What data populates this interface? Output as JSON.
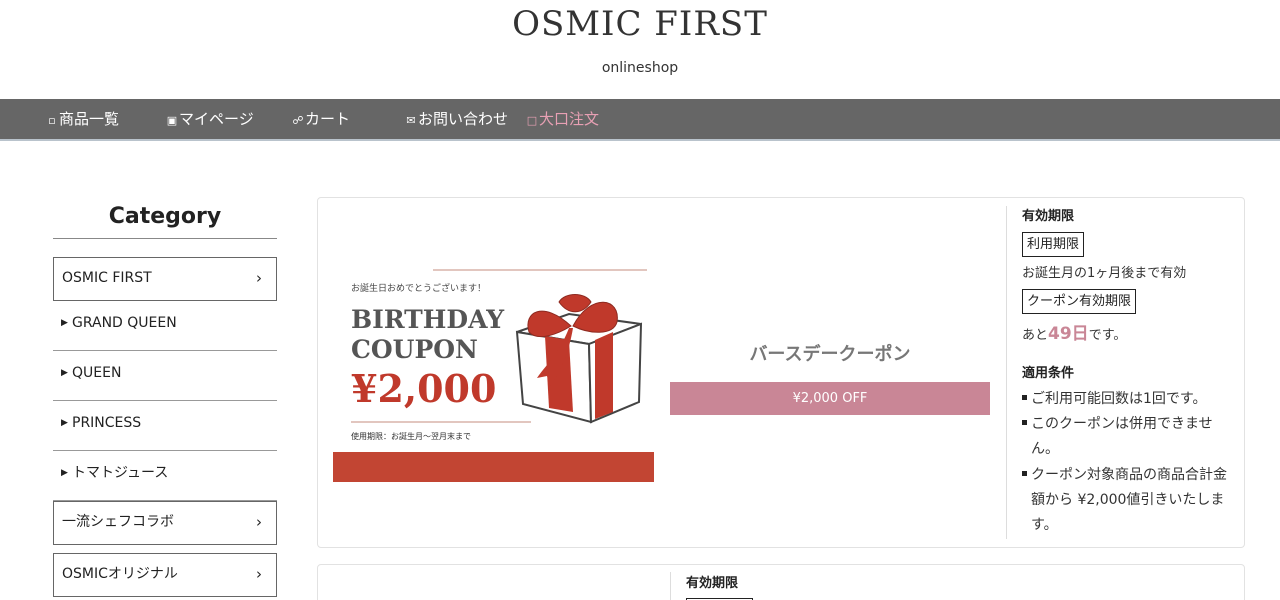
{
  "header": {
    "brand": "OSMIC FIRST",
    "subtitle": "onlineshop"
  },
  "nav": [
    {
      "label": "商品一覧",
      "icon": "shopping-bag-icon"
    },
    {
      "label": "マイページ",
      "icon": "lock-icon"
    },
    {
      "label": "カート",
      "icon": "cart-icon"
    },
    {
      "label": "お問い合わせ",
      "icon": "mail-icon"
    },
    {
      "label": "大口注文",
      "icon": "chat-icon",
      "color": "#e8a0b4"
    }
  ],
  "sidebar": {
    "title": "Category",
    "items": [
      {
        "label": "OSMIC FIRST",
        "type": "box"
      },
      {
        "label": "GRAND QUEEN",
        "type": "sub"
      },
      {
        "label": "QUEEN",
        "type": "sub"
      },
      {
        "label": "PRINCESS",
        "type": "sub"
      },
      {
        "label": "トマトジュース",
        "type": "sub"
      },
      {
        "label": "一流シェフコラボ",
        "type": "box"
      },
      {
        "label": "OSMICオリジナル",
        "type": "box"
      }
    ]
  },
  "coupon": {
    "image": {
      "greeting": "お誕生日おめでとうございます！",
      "line1": "BIRTHDAY",
      "line2": "COUPON",
      "amount": "¥2,000",
      "validity": "使用期限：お誕生月〜翌月末まで"
    },
    "name": "バースデークーポン",
    "off_label": "¥2,000 OFF",
    "validity_heading": "有効期限",
    "use_period_tag": "利用期限",
    "use_period_text": "お誕生月の1ヶ月後まで有効",
    "coupon_period_tag": "クーポン有効期限",
    "remaining_prefix": "あと",
    "remaining_days": "49日",
    "remaining_suffix": "です。",
    "conditions_heading": "適用条件",
    "conditions": [
      {
        "pre": "ご利用可能回数は",
        "accent": "1回",
        "post": "です。"
      },
      {
        "text_line1": "このクーポンは併用できませ",
        "text_line2": "ん。"
      },
      {
        "text_line1": "クーポン対象商品の商品合計金",
        "text_line2": "額から ¥2,000値引きいたしま",
        "text_line3": "す。"
      }
    ]
  },
  "coupon2": {
    "validity_heading": "有効期限"
  },
  "colors": {
    "nav_bg": "#666666",
    "accent_pink": "#c98696",
    "coupon_red": "#c0392b"
  }
}
